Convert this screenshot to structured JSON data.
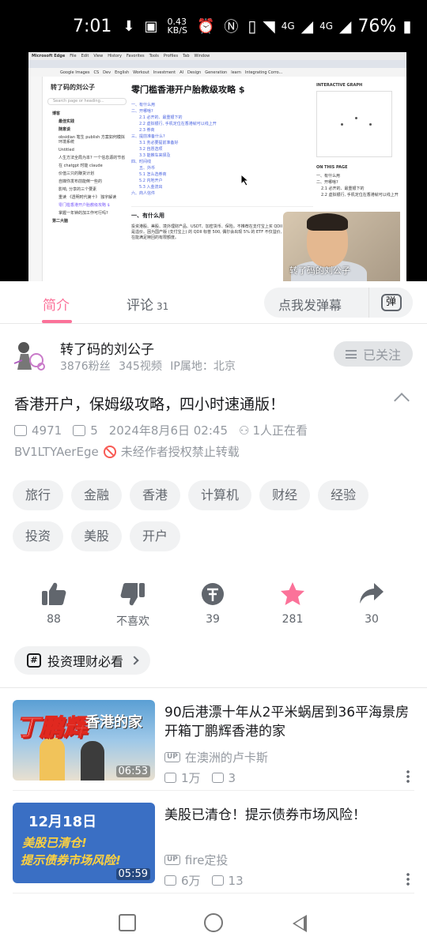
{
  "status_bar": {
    "time": "7:01",
    "net_speed": "0.43 KB/S",
    "network1": "4G",
    "network2": "4G",
    "battery": "76%"
  },
  "video": {
    "browser_menu": [
      "Microsoft Edge",
      "File",
      "Edit",
      "View",
      "History",
      "Favorites",
      "Tools",
      "Profiles",
      "Tab",
      "Window"
    ],
    "bookmarks": [
      "Google Images",
      "CS",
      "Dev",
      "English",
      "Workout",
      "Investment",
      "AI",
      "Design",
      "Generation",
      "learn",
      "Integrating Corro..."
    ],
    "vault_title": "转了码的刘公子",
    "search_placeholder": "Search page or heading...",
    "tree": [
      "博客",
      "最佳实践",
      "随意谈",
      "obsidian 笔生 publish 方案如何模拟环境系统",
      "Untitled",
      "人生方法全局为本? 一个信息源的节省",
      "在 chatgpt 时能 claude",
      "价值三只的赚货计划",
      "自媒你发布前能倒一些的",
      "影响, 分享的三个要素",
      "重读 《透明时代第十》 独字解读",
      "零门槛香港开户胎教级攻略 $",
      "掌握一年钟的加工作可行吗?",
      "第二大脑"
    ],
    "doc_title": "零门槛香港开户胎教级攻略 $",
    "toc": [
      "一、有什么用",
      "二、开哪啥?",
      "2.1 必开的、最重银下的",
      "2.2 虚拟银行, 手机定位在香港就可以线上开",
      "2.3 券商",
      "三、提前准备什么?",
      "3.1 务必要提前准备好",
      "3.2 自愿选项",
      "3.3 能推车来择及",
      "四、时间线",
      "五、外币",
      "5.1 怎么选券商",
      "5.2 内地开户",
      "5.3 入金流出",
      "六、商人信件"
    ],
    "section_heading": "一、有什么用",
    "body_text": "投资港股、美股、境外理财产品、USDT、加密货币、保险。不推荐在支付宝上买 QDII 标普500的原因是溢价。因为国产版 (支付宝上) 的 QDII 标普 500, 偶尔会出现 5% 的 ETF 不仅溢价, 而且会有一个还在能满足赎回的有限额度。",
    "graph_title": "INTERACTIVE GRAPH",
    "on_this_page": "ON THIS PAGE",
    "onpage_items": [
      "一、有什么用",
      "二、开哪啥?",
      "2.1 必开的、最重银下的",
      "2.2 虚拟银行, 手机定位在香港就可以线上开"
    ],
    "watermark": "转了码的刘公子"
  },
  "tabs": {
    "intro": "简介",
    "comments": "评论",
    "comment_count": "31"
  },
  "danmu": {
    "placeholder": "点我发弹幕",
    "button": "弹"
  },
  "uploader": {
    "name": "转了码的刘公子",
    "fans": "3876粉丝",
    "videos": "345视频",
    "ip": "IP属地：北京",
    "follow_label": "已关注"
  },
  "video_info": {
    "title": "香港开户，保姆级攻略，四小时速通版！",
    "plays": "4971",
    "danmaku": "5",
    "date": "2024年8月6日 02:45",
    "watching": "1人正在看",
    "bvid": "BV1LTYAerEge",
    "notice": "未经作者授权禁止转载"
  },
  "tags": [
    "旅行",
    "金融",
    "香港",
    "计算机",
    "财经",
    "经验",
    "投资",
    "美股",
    "开户"
  ],
  "actions": {
    "like": "88",
    "dislike": "不喜欢",
    "coin": "39",
    "favorite": "281",
    "share": "30"
  },
  "colors": {
    "accent": "#fb7299",
    "primary_text": "#18191c",
    "secondary_text": "#9499a0"
  },
  "topic": {
    "label": "投资理财必看"
  },
  "recommendations": [
    {
      "title": "90后港漂十年从2平米蜗居到36平海景房 开箱丁鹏辉香港的家",
      "uploader": "在澳洲的卢卡斯",
      "views": "1万",
      "danmaku": "3",
      "duration": "06:53",
      "thumb_big": "丁鹏辉",
      "thumb_small": "香港的家"
    },
    {
      "title": "美股已清仓！提示债券市场风险！",
      "uploader": "fire定投",
      "views": "6万",
      "danmaku": "13",
      "duration": "05:59",
      "thumb_date": "12月18日",
      "thumb_line1": "美股已清仓!",
      "thumb_line2": "提示债券市场风险!"
    }
  ]
}
